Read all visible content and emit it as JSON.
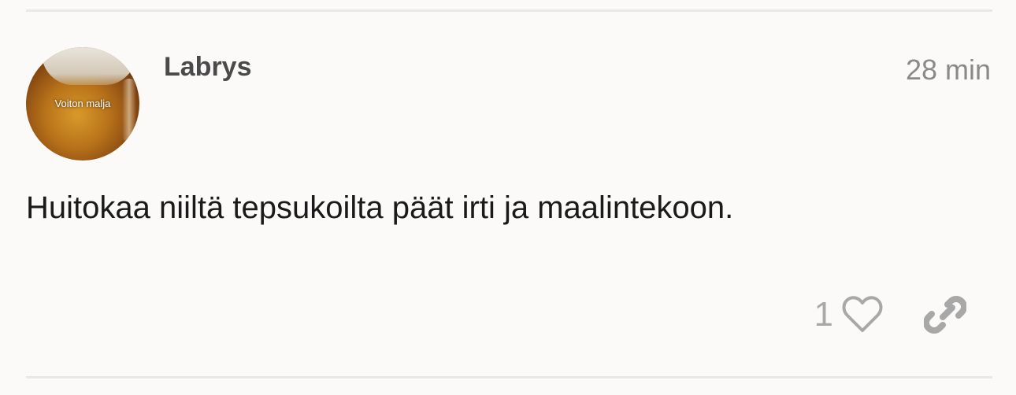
{
  "post": {
    "author": "Labrys",
    "timestamp": "28 min",
    "avatar_caption": "Voiton malja",
    "body": "Huitokaa niiltä tepsukoilta päät irti ja maalintekoon.",
    "like_count": "1",
    "icons": {
      "like": "heart-icon",
      "share": "link-icon"
    }
  }
}
